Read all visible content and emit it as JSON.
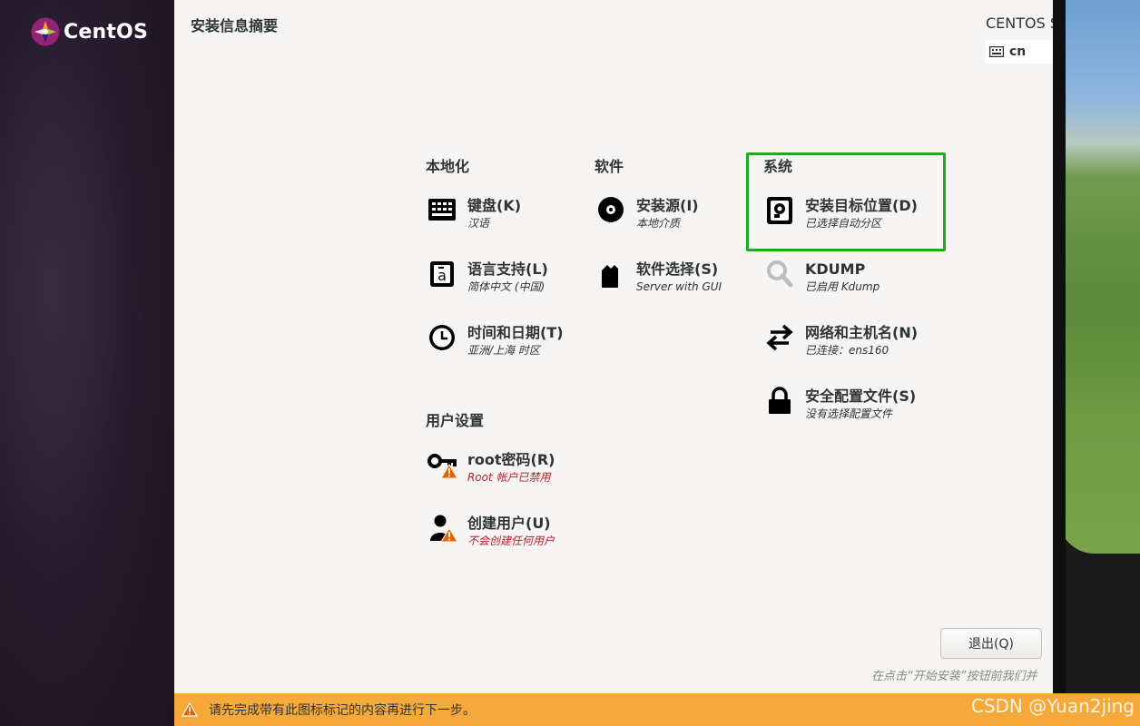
{
  "brand": {
    "logo_text": "CentOS"
  },
  "header": {
    "title": "安装信息摘要",
    "product": "CENTOS S",
    "keyboard_layout": "cn"
  },
  "sections": {
    "localization": {
      "title": "本地化",
      "items": [
        {
          "name": "键盘(K)",
          "status": "汉语",
          "icon": "keyboard-icon"
        },
        {
          "name": "语言支持(L)",
          "status": "简体中文 (中国)",
          "icon": "language-icon"
        },
        {
          "name": "时间和日期(T)",
          "status": "亚洲/上海 时区",
          "icon": "clock-icon"
        }
      ]
    },
    "software": {
      "title": "软件",
      "items": [
        {
          "name": "安装源(I)",
          "status": "本地介质",
          "icon": "disc-icon"
        },
        {
          "name": "软件选择(S)",
          "status": "Server with GUI",
          "icon": "package-icon"
        }
      ]
    },
    "system": {
      "title": "系统",
      "items": [
        {
          "name": "安装目标位置(D)",
          "status": "已选择自动分区",
          "icon": "harddisk-icon"
        },
        {
          "name": "KDUMP",
          "status": "已启用 Kdump",
          "icon": "magnifier-icon"
        },
        {
          "name": "网络和主机名(N)",
          "status": "已连接：ens160",
          "icon": "network-arrows-icon"
        },
        {
          "name": "安全配置文件(S)",
          "status": "没有选择配置文件",
          "icon": "lock-icon"
        }
      ]
    },
    "user": {
      "title": "用户设置",
      "items": [
        {
          "name": "root密码(R)",
          "status": "Root 帐户已禁用",
          "icon": "key-warning-icon"
        },
        {
          "name": "创建用户(U)",
          "status": "不会创建任何用户",
          "icon": "user-warning-icon"
        }
      ]
    }
  },
  "footer": {
    "quit_label": "退出(Q)",
    "hint": "在点击“开始安装”按钮前我们并",
    "warning": "请先完成带有此图标标记的内容再进行下一步。",
    "watermark": "CSDN @Yuan2jing"
  },
  "colors": {
    "sidebar": "#2a1f2f",
    "highlight": "#22a822",
    "warning_bar": "#f5a93b",
    "warning_text": "#c01c28"
  }
}
